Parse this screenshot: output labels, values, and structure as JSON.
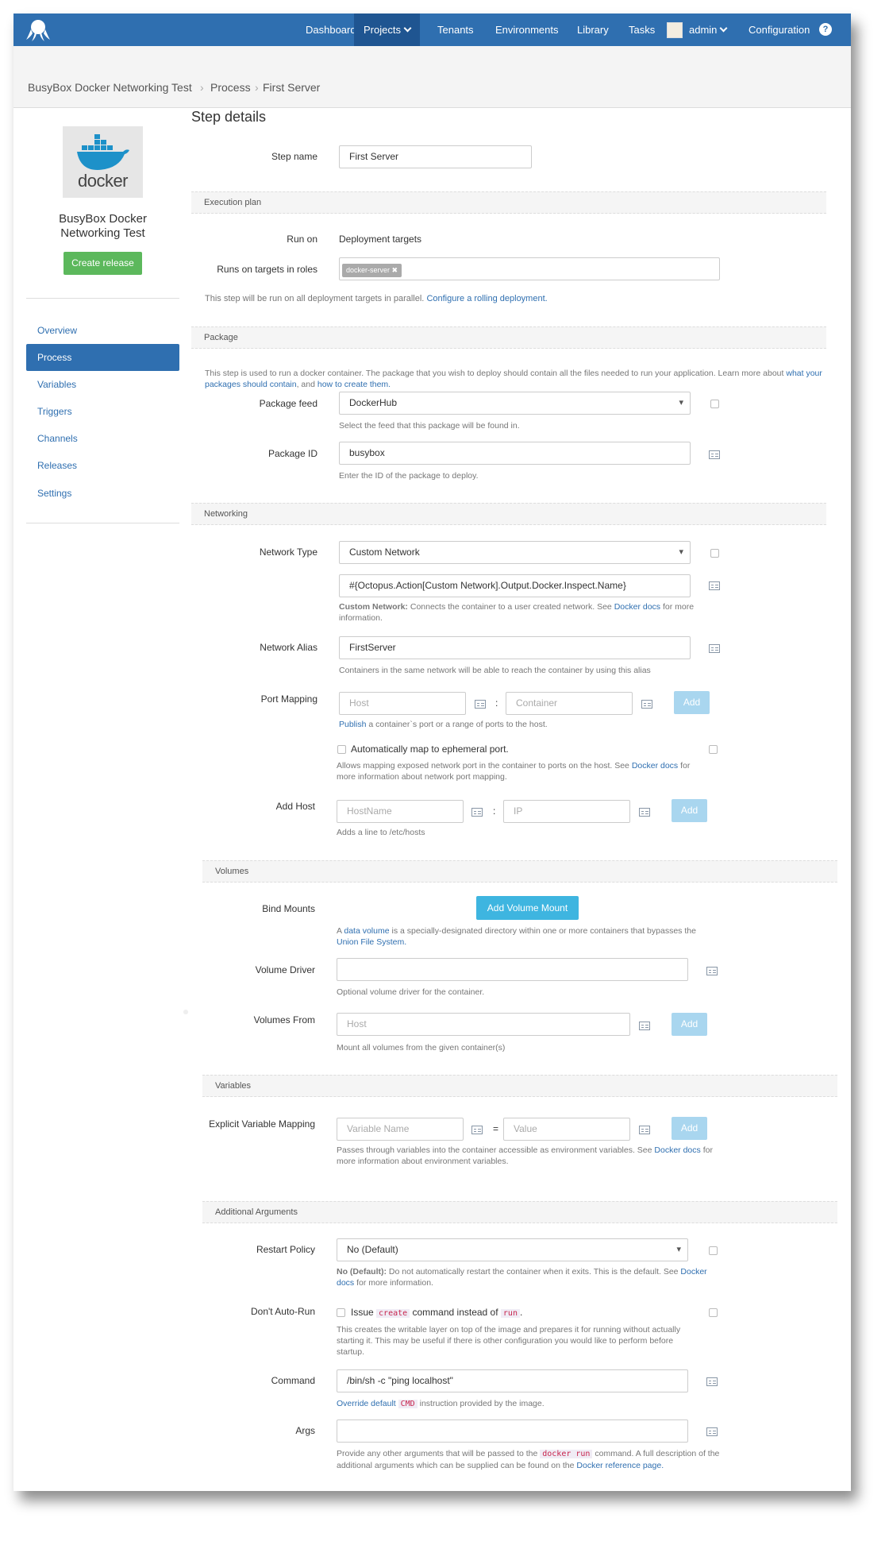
{
  "nav": {
    "items": [
      "Dashboard",
      "Projects",
      "Tenants",
      "Environments",
      "Library",
      "Tasks",
      "admin",
      "Configuration"
    ],
    "help": "?"
  },
  "breadcrumb": [
    "BusyBox Docker Networking Test",
    "Process",
    "First Server"
  ],
  "sidebar": {
    "logo_text": "docker",
    "project_name": "BusyBox Docker Networking Test",
    "create_release": "Create release",
    "items": [
      "Overview",
      "Process",
      "Variables",
      "Triggers",
      "Channels",
      "Releases",
      "Settings"
    ]
  },
  "step": {
    "title": "Step details",
    "name_label": "Step name",
    "name_value": "First Server"
  },
  "execution": {
    "section": "Execution plan",
    "run_on_label": "Run on",
    "run_on_value": "Deployment targets",
    "roles_label": "Runs on targets in roles",
    "role_tag": "docker-server",
    "note_text": "This step will be run on all deployment targets in parallel.",
    "note_link": "Configure a rolling deployment."
  },
  "package": {
    "section": "Package",
    "intro": "This step is used to run a docker container. The package that you wish to deploy should contain all the files needed to run your application. Learn more about",
    "intro_link1": "what your packages should contain",
    "intro_and": ", and",
    "intro_link2": "how to create them.",
    "feed_label": "Package feed",
    "feed_value": "DockerHub",
    "feed_help": "Select the feed that this package will be found in.",
    "id_label": "Package ID",
    "id_value": "busybox",
    "id_help": "Enter the ID of the package to deploy."
  },
  "networking": {
    "section": "Networking",
    "type_label": "Network Type",
    "type_value": "Custom Network",
    "custom_value": "#{Octopus.Action[Custom Network].Output.Docker.Inspect.Name}",
    "custom_help_bold": "Custom Network:",
    "custom_help": "Connects the container to a user created network. See",
    "custom_help_link": "Docker docs",
    "custom_help_end": "for more information.",
    "alias_label": "Network Alias",
    "alias_value": "FirstServer",
    "alias_help": "Containers in the same network will be able to reach the container by using this alias",
    "port_label": "Port Mapping",
    "port_host_ph": "Host",
    "port_container_ph": "Container",
    "port_sep": ":",
    "add": "Add",
    "port_help_link": "Publish",
    "port_help": "a container`s port or a range of ports to the host.",
    "ephemeral_label": "Automatically map to ephemeral port.",
    "ephemeral_help": "Allows mapping exposed network port in the container to ports on the host. See",
    "ephemeral_help_link": "Docker docs",
    "ephemeral_help_end": "for more information about network port mapping.",
    "addhost_label": "Add Host",
    "hostname_ph": "HostName",
    "ip_ph": "IP",
    "addhost_help": "Adds a line to /etc/hosts"
  },
  "volumes": {
    "section": "Volumes",
    "bind_label": "Bind Mounts",
    "add_volume": "Add Volume Mount",
    "bind_help1": "A",
    "bind_help_link1": "data volume",
    "bind_help2": "is a specially-designated directory within one or more containers that bypasses the",
    "bind_help_link2": "Union File System.",
    "driver_label": "Volume Driver",
    "driver_help": "Optional volume driver for the container.",
    "from_label": "Volumes From",
    "from_ph": "Host",
    "from_help": "Mount all volumes from the given container(s)"
  },
  "variables": {
    "section": "Variables",
    "mapping_label": "Explicit Variable Mapping",
    "name_ph": "Variable Name",
    "value_ph": "Value",
    "eq": "=",
    "help": "Passes through variables into the container accessible as environment variables. See",
    "help_link": "Docker docs",
    "help_end": "for more information about environment variables."
  },
  "additional": {
    "section": "Additional Arguments",
    "restart_label": "Restart Policy",
    "restart_value": "No (Default)",
    "restart_help_bold": "No (Default):",
    "restart_help": "Do not automatically restart the container when it exits. This is the default. See",
    "restart_help_link": "Docker docs",
    "restart_help_end": "for more information.",
    "autorun_label": "Don't Auto-Run",
    "autorun_chk1": "Issue",
    "autorun_code1": "create",
    "autorun_chk2": "command instead of",
    "autorun_code2": "run",
    "autorun_chk3": ".",
    "autorun_help": "This creates the writable layer on top of the image and prepares it for running without actually starting it. This may be useful if there is other configuration you would like to perform before startup.",
    "command_label": "Command",
    "command_value": "/bin/sh -c \"ping localhost\"",
    "command_help_link": "Override default",
    "command_help_code": "CMD",
    "command_help_end": "instruction provided by the image.",
    "args_label": "Args",
    "args_help1": "Provide any other arguments that will be passed to the",
    "args_help_code": "docker run",
    "args_help2": "command. A full description of the additional arguments which can be supplied can be found on the",
    "args_help_link": "Docker reference page."
  }
}
